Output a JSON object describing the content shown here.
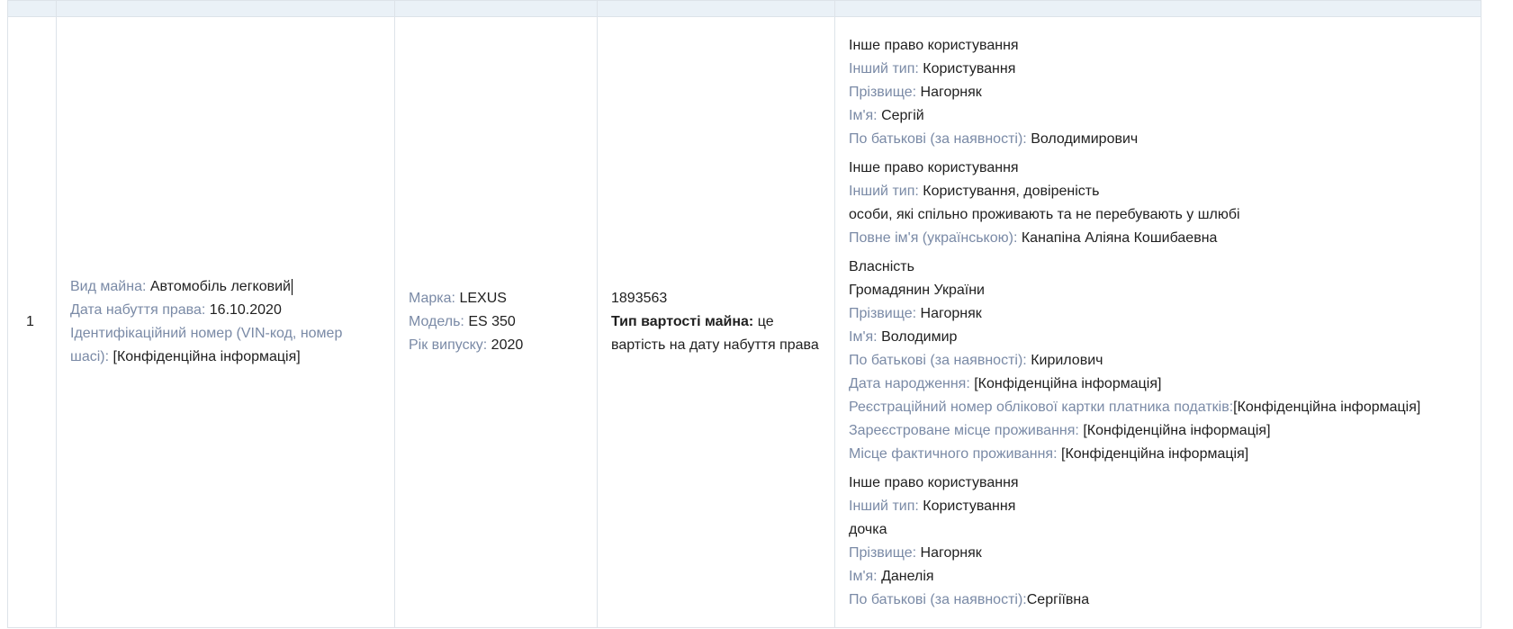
{
  "row": {
    "number": "1",
    "property": {
      "type_label": "Вид майна:",
      "type_value": "Автомобіль легковий",
      "date_label": "Дата набуття права:",
      "date_value": "16.10.2020",
      "vin_label": "Ідентифікаційний номер (VIN-код, номер шасі):",
      "vin_value": "[Конфіденційна інформація]"
    },
    "vehicle": {
      "brand_label": "Марка:",
      "brand_value": "LEXUS",
      "model_label": "Модель:",
      "model_value": "ES 350",
      "year_label": "Рік випуску:",
      "year_value": "2020"
    },
    "cost": {
      "value": "1893563",
      "type_label": "Тип вартості майна:",
      "type_value": "це вартість на дату набуття права"
    },
    "rights": [
      {
        "title": "Інше право користування",
        "other_type_label": "Інший тип:",
        "other_type_value": "Користування",
        "surname_label": "Прізвище:",
        "surname_value": "Нагорняк",
        "name_label": "Ім'я:",
        "name_value": "Сергій",
        "patronymic_label": "По батькові (за наявності):",
        "patronymic_value": "Володимирович"
      },
      {
        "title": "Інше право користування",
        "other_type_label": "Інший тип:",
        "other_type_value": "Користування, довіреність",
        "relation": "особи, які спільно проживають та не перебувають у шлюбі",
        "fullname_label": "Повне ім'я (українською):",
        "fullname_value": "Канапіна Аліяна Кошибаевна"
      },
      {
        "title": "Власність",
        "citizenship": "Громадянин України",
        "surname_label": "Прізвище:",
        "surname_value": "Нагорняк",
        "name_label": "Ім'я:",
        "name_value": "Володимир",
        "patronymic_label": "По батькові (за наявності):",
        "patronymic_value": "Кирилович",
        "birth_label": "Дата народження:",
        "birth_value": "[Конфіденційна інформація]",
        "tax_label": "Реєстраційний номер облікової картки платника податків:",
        "tax_value": "[Конфіденційна інформація]",
        "reg_label": "Зареєстроване місце проживання:",
        "reg_value": "[Конфіденційна інформація]",
        "actual_label": "Місце фактичного проживання:",
        "actual_value": "[Конфіденційна інформація]"
      },
      {
        "title": "Інше право користування",
        "other_type_label": "Інший тип:",
        "other_type_value": "Користування",
        "relation": "дочка",
        "surname_label": "Прізвище:",
        "surname_value": "Нагорняк",
        "name_label": "Ім'я:",
        "name_value": "Данелія",
        "patronymic_label": "По батькові (за наявності):",
        "patronymic_value": "Сергіївна"
      }
    ]
  }
}
